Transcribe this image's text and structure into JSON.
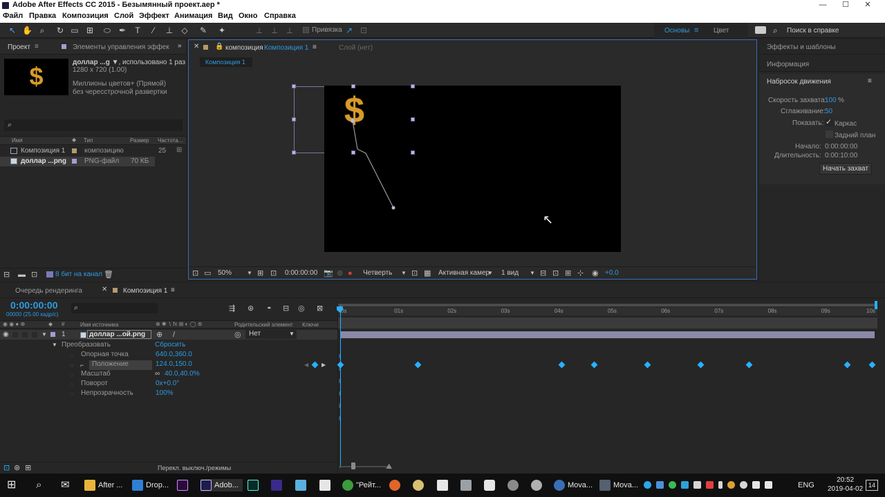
{
  "window": {
    "title": "Adobe After Effects CC 2015 - Безымянный проект.aep *",
    "min": "—",
    "max": "☐",
    "close": "✕"
  },
  "menu": [
    "Файл",
    "Правка",
    "Композиция",
    "Слой",
    "Эффект",
    "Анимация",
    "Вид",
    "Окно",
    "Справка"
  ],
  "toolbar": {
    "snap_label": "Привязка",
    "workspace": "Основы",
    "workspace2": "Цвет",
    "help_search": "Поиск в справке"
  },
  "project_panel": {
    "tab1": "Проект",
    "tab2": "Элементы управления эффек",
    "item_name": "доллар ...g ▼",
    "item_usage": ", использовано 1 раз",
    "item_dims": "1280 x 720 (1.00)",
    "item_color": "Миллионы цветов+ (Прямой)",
    "item_interlace": "без чересстрочной развертки",
    "thumb_glyph": "$",
    "search_icon": "⌕",
    "columns": {
      "name": "Имя",
      "type": "Тип",
      "size": "Размер",
      "fps": "Частота..."
    },
    "rows": [
      {
        "name": "Композиция 1",
        "type": "композицию",
        "size": "",
        "fps": "25",
        "color": "#b59a6b"
      },
      {
        "name": "доллар ...png",
        "type": "PNG-файл",
        "size": "70 КБ",
        "fps": "",
        "color": "#a99bd1"
      }
    ],
    "bit_depth": "8 бит на канал"
  },
  "comp_panel": {
    "tab_prefix": "композиция",
    "tab_name": "Композиция 1",
    "layer_tab": "Слой (нет)",
    "flow_label": "Композиция 1",
    "zoom": "50%",
    "timecode": "0:00:00:00",
    "resolution": "Четверть",
    "camera": "Активная камер",
    "views": "1 вид",
    "exposure": "+0.0",
    "glyph": "$"
  },
  "right_panel": {
    "effects": "Эффекты и шаблоны",
    "info": "Информация",
    "title": "Набросок движения",
    "speed_label": "Скорость захвата:",
    "speed_value": "100",
    "speed_unit": "%",
    "smooth_label": "Сглаживание:",
    "smooth_value": "50",
    "show_label": "Показать:",
    "wireframe": "Каркас",
    "background": "Задний план",
    "start_label": "Начало:",
    "start_value": "0:00:00:00",
    "duration_label": "Длительность:",
    "duration_value": "0:00:10:00",
    "capture_button": "Начать захват"
  },
  "timeline": {
    "tab_render": "Очередь рендеринга",
    "tab_comp": "Композиция 1",
    "timecode": "0:00:00:00",
    "frame_info": "00000 (25.00 кадр/с)",
    "col_source": "Имя источника",
    "col_parent": "Родительский элемент",
    "col_keys": "Ключи",
    "layer_num": "1",
    "layer_name": "доллар ...ой.png",
    "parent_value": "Нет",
    "transform": "Преобразовать",
    "reset": "Сбросить",
    "props": [
      {
        "name": "Опорная точка",
        "value": "640.0,360.0"
      },
      {
        "name": "Положение",
        "value": "124.0,150.0"
      },
      {
        "name": "Масштаб",
        "value": "40.0,40.0%"
      },
      {
        "name": "Поворот",
        "value": "0x+0.0°"
      },
      {
        "name": "Непрозрачность",
        "value": "100%"
      }
    ],
    "ruler": [
      "0s",
      "01s",
      "02s",
      "03s",
      "04s",
      "05s",
      "06s",
      "07s",
      "08s",
      "09s",
      "10s"
    ],
    "keyframe_times_s": [
      0,
      1.45,
      4.15,
      4.75,
      5.75,
      6.75,
      7.65,
      9.5,
      10
    ],
    "duration_s": 10,
    "footer": "Перекл. выключ./режимы"
  },
  "taskbar": {
    "items": [
      {
        "label": "After ...",
        "color": "#e8b43c"
      },
      {
        "label": "Drop...",
        "color": "#2f7fd6"
      },
      {
        "label": "Adob...",
        "color": "#1d1d4a"
      },
      {
        "label": "\"Рейт...",
        "color": "#3c9b3c"
      },
      {
        "label": "Mova...",
        "color": "#3a6fb5"
      },
      {
        "label": "Mova...",
        "color": "#556070"
      }
    ],
    "lang": "ENG",
    "time": "20:52",
    "date": "2019-04-02",
    "notif": "14"
  }
}
